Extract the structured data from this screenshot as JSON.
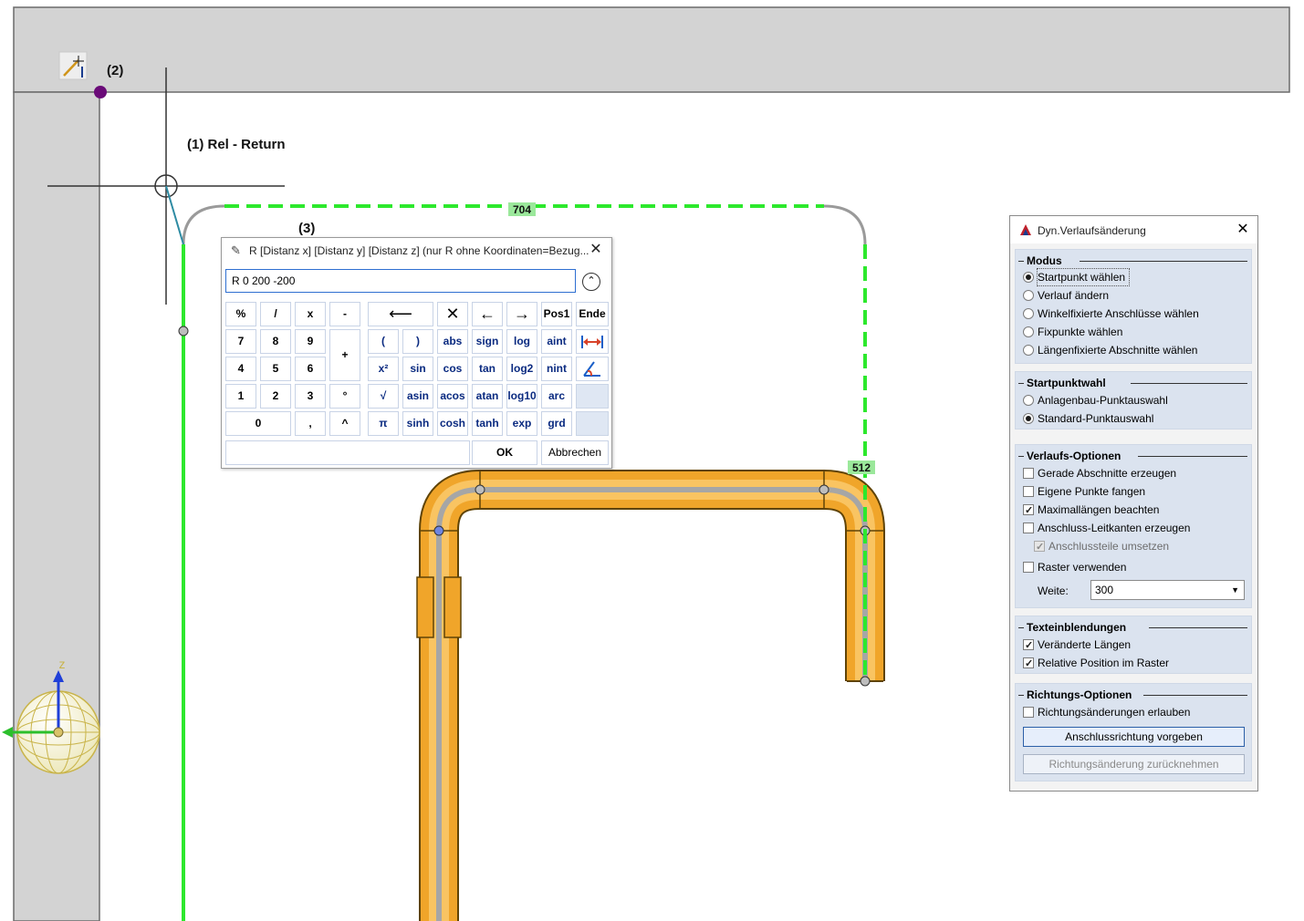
{
  "annotations": {
    "point_label_2": "(2)",
    "rel_return": "(1) Rel - Return",
    "point_label_3": "(3)"
  },
  "dimensions": {
    "top_length": "704",
    "right_length": "512"
  },
  "axis": {
    "z_label": "z"
  },
  "colors": {
    "pipe": "#f0a52a",
    "path_green": "#2de82d",
    "point_purple": "#6a0a78",
    "dim_badge": "#9be89b"
  },
  "calculator": {
    "title": "R [Distanz x] [Distanz y] [Distanz z] (nur R ohne Koordinaten=Bezug...",
    "expression": "R 0 200 -200",
    "buttons": {
      "percent": "%",
      "divide": "/",
      "multiply": "x",
      "minus": "-",
      "plus": "+",
      "d7": "7",
      "d8": "8",
      "d9": "9",
      "d4": "4",
      "d5": "5",
      "d6": "6",
      "d1": "1",
      "d2": "2",
      "d3": "3",
      "d0": "0",
      "degree": "°",
      "comma": ",",
      "power": "^",
      "paren_open": "(",
      "paren_close": ")",
      "abs": "abs",
      "sign": "sign",
      "log": "log",
      "aint": "aint",
      "square": "x²",
      "sin": "sin",
      "cos": "cos",
      "tan": "tan",
      "log2": "log2",
      "nint": "nint",
      "sqrt": "√",
      "asin": "asin",
      "acos": "acos",
      "atan": "atan",
      "log10": "log10",
      "arc": "arc",
      "pi": "π",
      "sinh": "sinh",
      "cosh": "cosh",
      "tanh": "tanh",
      "exp": "exp",
      "grd": "grd",
      "pos1": "Pos1",
      "ende": "Ende",
      "ok": "OK",
      "cancel": "Abbrechen"
    }
  },
  "panel": {
    "title": "Dyn.Verlaufsänderung",
    "modus": {
      "title": "Modus",
      "options": [
        {
          "label": "Startpunkt wählen",
          "selected": true
        },
        {
          "label": "Verlauf ändern",
          "selected": false
        },
        {
          "label": "Winkelfixierte Anschlüsse wählen",
          "selected": false
        },
        {
          "label": "Fixpunkte wählen",
          "selected": false
        },
        {
          "label": "Längenfixierte Abschnitte wählen",
          "selected": false
        }
      ]
    },
    "startpunktwahl": {
      "title": "Startpunktwahl",
      "options": [
        {
          "label": "Anlagenbau-Punktauswahl",
          "selected": false
        },
        {
          "label": "Standard-Punktauswahl",
          "selected": true
        }
      ]
    },
    "verlaufs_optionen": {
      "title": "Verlaufs-Optionen",
      "checks": [
        {
          "label": "Gerade Abschnitte erzeugen",
          "checked": false
        },
        {
          "label": "Eigene Punkte fangen",
          "checked": false
        },
        {
          "label": "Maximallängen beachten",
          "checked": true
        },
        {
          "label": "Anschluss-Leitkanten erzeugen",
          "checked": false
        },
        {
          "label": "Anschlussteile umsetzen",
          "checked": true,
          "disabled": true
        },
        {
          "label": "Raster verwenden",
          "checked": false
        }
      ],
      "weite_label": "Weite:",
      "weite_value": "300"
    },
    "texteinblendungen": {
      "title": "Texteinblendungen",
      "checks": [
        {
          "label": "Veränderte Längen",
          "checked": true
        },
        {
          "label": "Relative Position im Raster",
          "checked": true
        }
      ]
    },
    "richtungs_optionen": {
      "title": "Richtungs-Optionen",
      "checks": [
        {
          "label": "Richtungsänderungen erlauben",
          "checked": false
        }
      ],
      "button_set": "Anschlussrichtung vorgeben",
      "button_undo": "Richtungsänderung zurücknehmen"
    }
  }
}
